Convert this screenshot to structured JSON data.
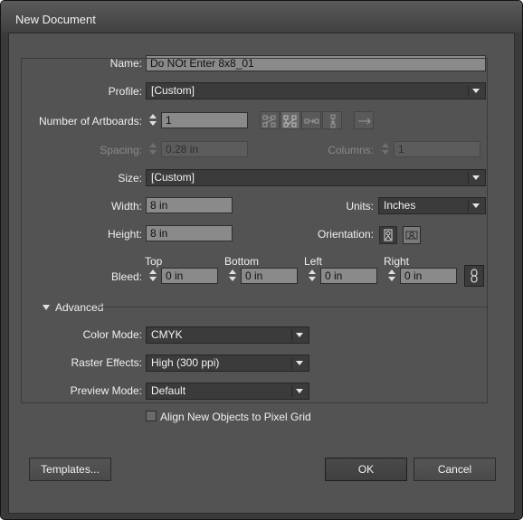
{
  "window": {
    "title": "New Document"
  },
  "name": {
    "label": "Name:",
    "value": "Do NOt Enter 8x8_01"
  },
  "profile": {
    "label": "Profile:",
    "value": "[Custom]"
  },
  "artboards": {
    "label": "Number of Artboards:",
    "value": "1"
  },
  "spacing": {
    "label": "Spacing:",
    "value": "0.28 in"
  },
  "columns": {
    "label": "Columns:",
    "value": "1"
  },
  "size": {
    "label": "Size:",
    "value": "[Custom]"
  },
  "width": {
    "label": "Width:",
    "value": "8 in"
  },
  "units": {
    "label": "Units:",
    "value": "Inches"
  },
  "height": {
    "label": "Height:",
    "value": "8 in"
  },
  "orientation": {
    "label": "Orientation:",
    "selected": "portrait"
  },
  "bleed": {
    "label": "Bleed:",
    "top": {
      "label": "Top",
      "value": "0 in"
    },
    "bottom": {
      "label": "Bottom",
      "value": "0 in"
    },
    "left": {
      "label": "Left",
      "value": "0 in"
    },
    "right": {
      "label": "Right",
      "value": "0 in"
    }
  },
  "advanced": {
    "label": "Advanced",
    "expanded": true
  },
  "color_mode": {
    "label": "Color Mode:",
    "value": "CMYK"
  },
  "raster_effects": {
    "label": "Raster Effects:",
    "value": "High (300 ppi)"
  },
  "preview_mode": {
    "label": "Preview Mode:",
    "value": "Default"
  },
  "align_pixel_grid": {
    "label": "Align New Objects to Pixel Grid",
    "checked": false
  },
  "buttons": {
    "templates": "Templates...",
    "ok": "OK",
    "cancel": "Cancel"
  },
  "icons": {
    "layout": [
      "grid-by-row-icon",
      "grid-by-column-icon",
      "arrange-by-row-icon",
      "arrange-by-column-icon"
    ],
    "direction": "right-to-left-layout-icon",
    "link": "link-bleed-icon"
  },
  "colors": {
    "panel": "#535353",
    "field": "#8a8a8a",
    "dropdown": "#3b3b3b",
    "window": "#3a3a3a"
  }
}
